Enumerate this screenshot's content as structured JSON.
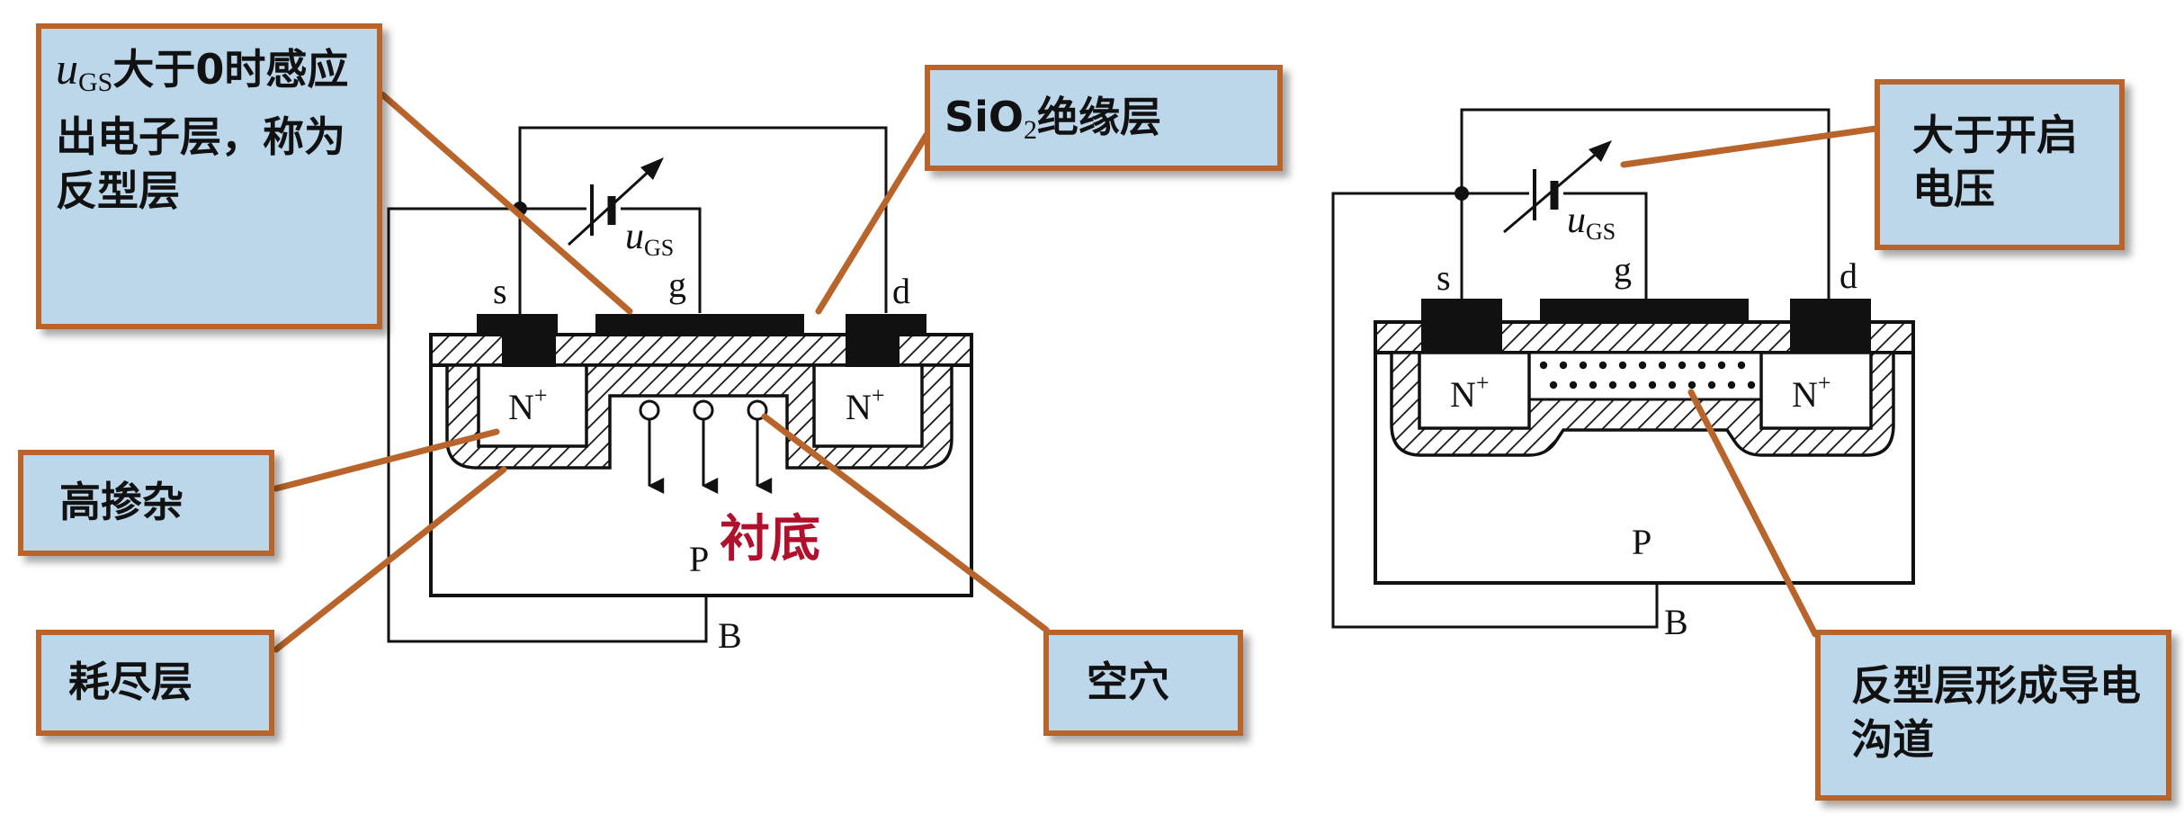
{
  "left": {
    "terminals": {
      "s": "s",
      "g": "g",
      "d": "d",
      "b": "B"
    },
    "region_n1": "N",
    "region_n2": "N",
    "n_sup": "+",
    "substrate_type": "P",
    "substrate_label": "衬底",
    "ugs_u": "u",
    "ugs_sub": "GS"
  },
  "right": {
    "terminals": {
      "s": "s",
      "g": "g",
      "d": "d",
      "b": "B"
    },
    "region_n1": "N",
    "region_n2": "N",
    "n_sup": "+",
    "substrate_type": "P",
    "ugs_u": "u",
    "ugs_sub": "GS"
  },
  "callouts": {
    "inversion": {
      "u": "u",
      "sub": "GS",
      "rest": "大于0时感应出电子层，称为反型层"
    },
    "sio2": {
      "pre": "SiO",
      "sub": "2",
      "rest": "绝缘层"
    },
    "doping": "高掺杂",
    "depletion": "耗尽层",
    "holes": "空穴",
    "threshold": "大于开启电压",
    "channel": "反型层形成导电沟道"
  },
  "colors": {
    "callout_fill": "#bcd6ea",
    "callout_border": "#b8642a",
    "leader": "#b8642a",
    "substrate_label": "#b0102c"
  }
}
